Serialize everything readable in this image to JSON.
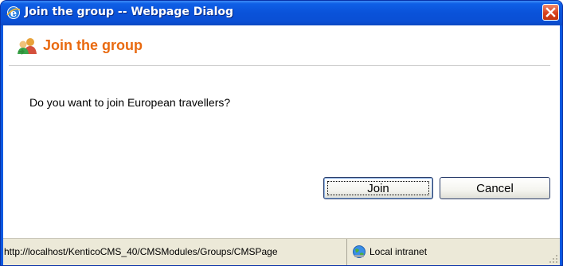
{
  "window": {
    "title": "Join the group -- Webpage Dialog"
  },
  "dialog": {
    "title": "Join the group",
    "message": "Do you want to join European travellers?",
    "join_label": "Join",
    "cancel_label": "Cancel"
  },
  "statusbar": {
    "url": "http://localhost/KenticoCMS_40/CMSModules/Groups/CMSPage",
    "zone": "Local intranet"
  },
  "icons": {
    "title": "ie-icon",
    "close": "close-icon",
    "header": "group-icon",
    "zone": "globe-icon",
    "grip": "resize-grip-icon"
  },
  "colors": {
    "titlebar": "#0a52d9",
    "heading": "#e96a10",
    "close": "#d8411c",
    "statusbar": "#ece9d8"
  }
}
